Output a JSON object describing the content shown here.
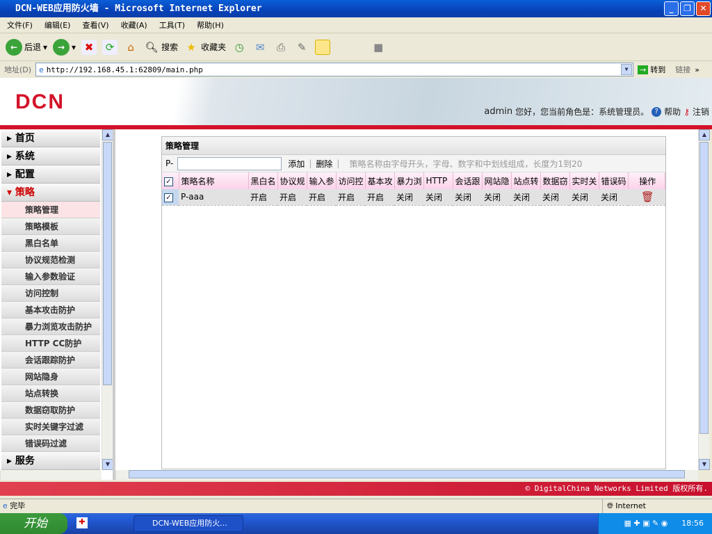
{
  "window": {
    "title": "DCN-WEB应用防火墙 - Microsoft Internet Explorer"
  },
  "menu": [
    "文件(F)",
    "编辑(E)",
    "查看(V)",
    "收藏(A)",
    "工具(T)",
    "帮助(H)"
  ],
  "toolbar": {
    "back": "后退",
    "search": "搜索",
    "favorites": "收藏夹"
  },
  "address": {
    "label": "地址(D)",
    "url": "http://192.168.45.1:62809/main.php",
    "go": "转到",
    "links": "链接"
  },
  "banner": {
    "logo": "DCN",
    "user": "admin",
    "greeting": "您好，您当前角色是：系统管理员。",
    "help": "帮助",
    "logout": "注销"
  },
  "sidebar": {
    "top": [
      "首页",
      "系统",
      "配置"
    ],
    "open": "策略",
    "subs": [
      "策略管理",
      "策略模板",
      "黑白名单",
      "协议规范检测",
      "输入参数验证",
      "访问控制",
      "基本攻击防护",
      "暴力浏览攻击防护",
      "HTTP CC防护",
      "会话跟踪防护",
      "网站隐身",
      "站点转换",
      "数据窃取防护",
      "实时关键字过滤",
      "错误码过滤"
    ],
    "bottom": "服务"
  },
  "panel": {
    "title": "策略管理",
    "prefix": "P-",
    "input_value": "",
    "add": "添加",
    "delete": "删除",
    "hint": "策略名称由字母开头，字母、数字和中划线组成，长度为1到20",
    "columns": [
      "策略名称",
      "黑白名",
      "协议规",
      "输入参",
      "访问控",
      "基本攻",
      "暴力浏",
      "HTTP",
      "会话跟",
      "网站隐",
      "站点转",
      "数据窃",
      "实时关",
      "错误码",
      "操作"
    ],
    "rows": [
      {
        "name": "P-aaa",
        "checked": true,
        "values": [
          "开启",
          "开启",
          "开启",
          "开启",
          "开启",
          "关闭",
          "关闭",
          "关闭",
          "关闭",
          "关闭",
          "关闭",
          "关闭",
          "关闭"
        ]
      }
    ]
  },
  "footer": "© DigitalChina Networks Limited 版权所有.",
  "status": {
    "text": "完毕",
    "zone": "Internet"
  },
  "taskbar": {
    "start": "开始",
    "task": "DCN-WEB应用防火...",
    "time": "18:56"
  }
}
